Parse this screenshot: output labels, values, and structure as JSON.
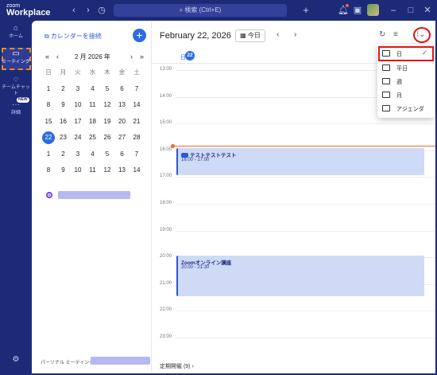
{
  "titlebar": {
    "logo_line1": "zoom",
    "logo_line2": "Workplace",
    "search_placeholder": "検索 (Ctrl+E)"
  },
  "rail": {
    "home": "ホーム",
    "meetings": "ミーティング",
    "team_chat": "チームチャット",
    "new_badge": "NEW",
    "more": "詳細"
  },
  "mini": {
    "connect_label": "カレンダーを接続",
    "month_label": "2 月 2026 年",
    "weekdays": [
      "日",
      "月",
      "火",
      "水",
      "木",
      "金",
      "土"
    ],
    "weeks": [
      [
        "1",
        "2",
        "3",
        "4",
        "5",
        "6",
        "7"
      ],
      [
        "8",
        "9",
        "10",
        "11",
        "12",
        "13",
        "14"
      ],
      [
        "15",
        "16",
        "17",
        "18",
        "19",
        "20",
        "21"
      ],
      [
        "22",
        "23",
        "24",
        "25",
        "26",
        "27",
        "28"
      ],
      [
        "1",
        "2",
        "3",
        "4",
        "5",
        "6",
        "7"
      ],
      [
        "8",
        "9",
        "10",
        "11",
        "12",
        "13",
        "14"
      ]
    ],
    "today": "22",
    "pmi_label": "パーソナル ミーティング ID"
  },
  "main": {
    "date_title": "February 22, 2026",
    "today_button": "今日",
    "day_letter": "日",
    "day_number": "22",
    "hours": [
      "13:00",
      "14:00",
      "15:00",
      "16:00",
      "17:00",
      "18:00",
      "19:00",
      "20:00",
      "21:00",
      "22:00",
      "23:00"
    ],
    "events": [
      {
        "title": "テストテストテスト",
        "time": "16:00 - 17:00"
      },
      {
        "title": "Zoomオンライン講座",
        "time": "20:00 - 21:30"
      }
    ],
    "recurring": "定期開催 (9)  ›"
  },
  "view_menu": {
    "items": [
      "日",
      "平日",
      "週",
      "月",
      "アジェンダ"
    ],
    "selected": "日"
  },
  "colors": {
    "accent": "#2d6cdf",
    "rail": "#1c2a78",
    "event_bg": "#cfdaf6",
    "now_line": "#ef6a2c",
    "highlight": "#e01515"
  }
}
